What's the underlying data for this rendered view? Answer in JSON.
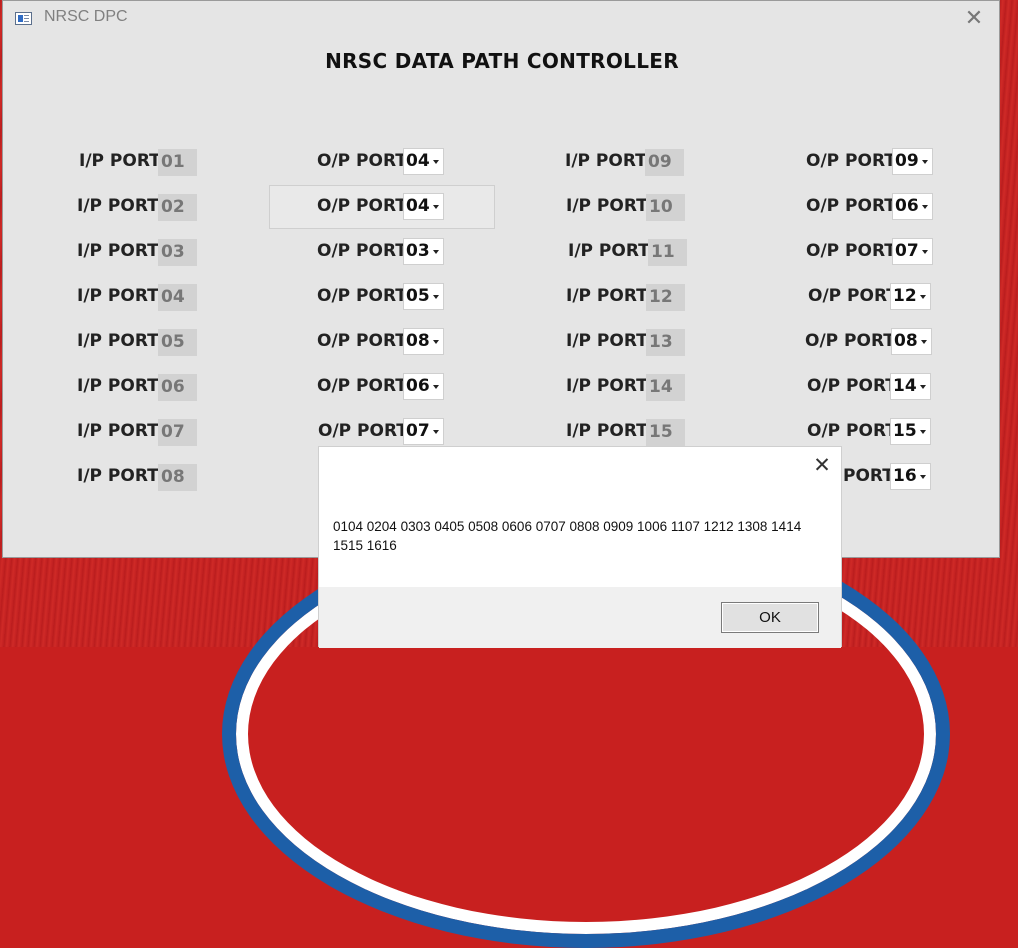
{
  "window": {
    "title": "NRSC DPC",
    "close_glyph": "✕"
  },
  "heading": "NRSC DATA PATH CONTROLLER",
  "ip_label": "I/P PORT",
  "op_label": "O/P PORT",
  "left_ports": [
    {
      "ip": "01",
      "op": "04"
    },
    {
      "ip": "02",
      "op": "04"
    },
    {
      "ip": "03",
      "op": "03"
    },
    {
      "ip": "04",
      "op": "05"
    },
    {
      "ip": "05",
      "op": "08"
    },
    {
      "ip": "06",
      "op": "06"
    },
    {
      "ip": "07",
      "op": "07"
    },
    {
      "ip": "08",
      "op": ""
    }
  ],
  "right_ports": [
    {
      "ip": "09",
      "op": "09"
    },
    {
      "ip": "10",
      "op": "06"
    },
    {
      "ip": "11",
      "op": "07"
    },
    {
      "ip": "12",
      "op": "12"
    },
    {
      "ip": "13",
      "op": "08"
    },
    {
      "ip": "14",
      "op": "14"
    },
    {
      "ip": "15",
      "op": "15"
    },
    {
      "ip": "",
      "op": "16"
    }
  ],
  "partial_op_label": "PORT",
  "dialog": {
    "message": "0104 0204 0303 0405 0508 0606 0707 0808 0909 1006 1107 1212 1308 1414 1515 1616",
    "ok_label": "OK",
    "close_glyph": "✕"
  }
}
